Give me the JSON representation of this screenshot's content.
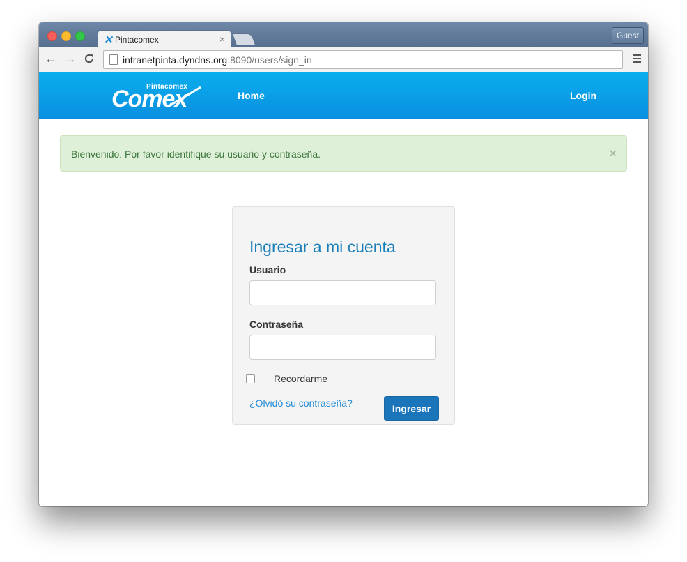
{
  "browser": {
    "tab_title": "Pintacomex",
    "tab_close": "×",
    "guest_label": "Guest",
    "url_host": "intranetpinta.dyndns.org",
    "url_rest": ":8090/users/sign_in",
    "nav_back": "←",
    "nav_forward": "→",
    "nav_reload": "C"
  },
  "navbar": {
    "logo_small": "Pintacomex",
    "logo_big": "Comex",
    "home_label": "Home",
    "login_label": "Login"
  },
  "alert": {
    "message": "Bienvenido. Por favor identifique su usuario y contraseña.",
    "close": "×"
  },
  "login_form": {
    "title": "Ingresar a mi cuenta",
    "username_label": "Usuario",
    "username_value": "",
    "password_label": "Contraseña",
    "password_value": "",
    "remember_label": "Recordarme",
    "remember_checked": false,
    "forgot_link": "¿Olvidó su contraseña?",
    "submit_label": "Ingresar"
  },
  "colors": {
    "navbar": "#0a9fe8",
    "alert_bg": "#dff0d8",
    "alert_text": "#3c763d",
    "title": "#1a7fb8",
    "button": "#1b75bb",
    "link": "#1f8ad6"
  }
}
